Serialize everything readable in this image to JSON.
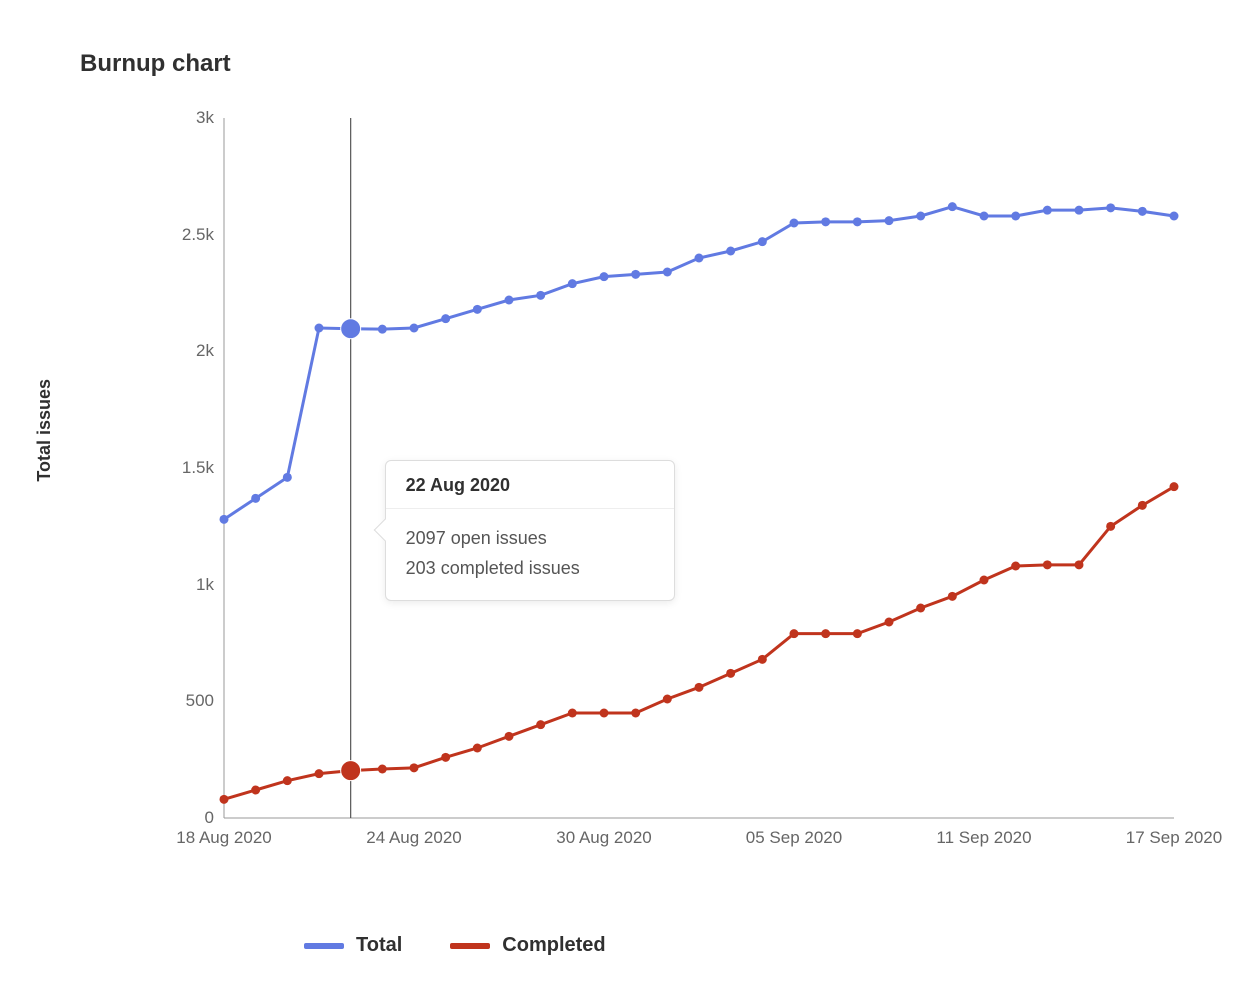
{
  "title": "Burnup chart",
  "y_axis_label": "Total issues",
  "chart_data": {
    "type": "line",
    "ylabel": "Total issues",
    "xlabel": "",
    "ylim": [
      0,
      3000
    ],
    "x_tick_labels": [
      "18 Aug 2020",
      "24 Aug 2020",
      "30 Aug 2020",
      "05 Sep 2020",
      "11 Sep 2020",
      "17 Sep 2020"
    ],
    "x_tick_indices": [
      0,
      6,
      12,
      18,
      24,
      30
    ],
    "y_ticks": [
      {
        "v": 0,
        "label": "0"
      },
      {
        "v": 500,
        "label": "500"
      },
      {
        "v": 1000,
        "label": "1k"
      },
      {
        "v": 1500,
        "label": "1.5k"
      },
      {
        "v": 2000,
        "label": "2k"
      },
      {
        "v": 2500,
        "label": "2.5k"
      },
      {
        "v": 3000,
        "label": "3k"
      }
    ],
    "dates": [
      "18 Aug 2020",
      "19 Aug 2020",
      "20 Aug 2020",
      "21 Aug 2020",
      "22 Aug 2020",
      "23 Aug 2020",
      "24 Aug 2020",
      "25 Aug 2020",
      "26 Aug 2020",
      "27 Aug 2020",
      "28 Aug 2020",
      "29 Aug 2020",
      "30 Aug 2020",
      "31 Aug 2020",
      "01 Sep 2020",
      "02 Sep 2020",
      "03 Sep 2020",
      "04 Sep 2020",
      "05 Sep 2020",
      "06 Sep 2020",
      "07 Sep 2020",
      "08 Sep 2020",
      "09 Sep 2020",
      "10 Sep 2020",
      "11 Sep 2020",
      "12 Sep 2020",
      "13 Sep 2020",
      "14 Sep 2020",
      "15 Sep 2020",
      "16 Sep 2020",
      "17 Sep 2020"
    ],
    "series": [
      {
        "name": "Total",
        "color": "#617ae2",
        "values": [
          1280,
          1370,
          1460,
          2100,
          2097,
          2095,
          2100,
          2140,
          2180,
          2220,
          2240,
          2290,
          2320,
          2330,
          2340,
          2400,
          2430,
          2470,
          2550,
          2555,
          2555,
          2560,
          2580,
          2620,
          2580,
          2580,
          2605,
          2605,
          2615,
          2600,
          2580
        ]
      },
      {
        "name": "Completed",
        "color": "#c0341d",
        "values": [
          80,
          120,
          160,
          190,
          203,
          210,
          215,
          260,
          300,
          350,
          400,
          450,
          450,
          450,
          510,
          560,
          620,
          680,
          790,
          790,
          790,
          840,
          900,
          950,
          1020,
          1080,
          1085,
          1085,
          1250,
          1340,
          1420
        ]
      }
    ],
    "hover_index": 4,
    "tooltip": {
      "date": "22 Aug 2020",
      "line1": "2097 open issues",
      "line2": "203 completed issues"
    }
  },
  "legend": {
    "total": "Total",
    "completed": "Completed"
  }
}
